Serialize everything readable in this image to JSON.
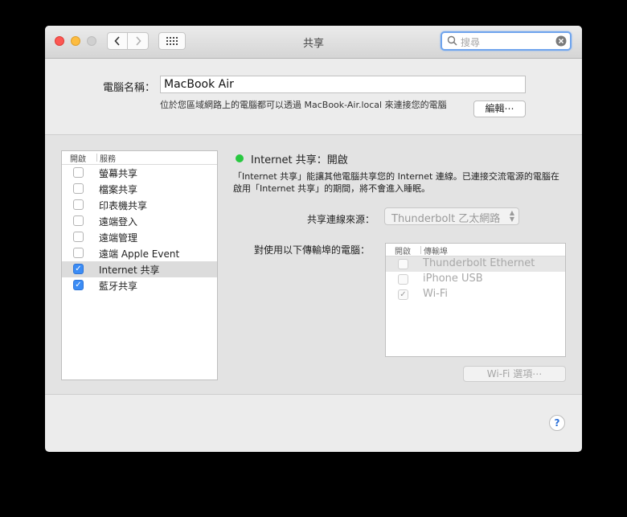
{
  "window": {
    "title": "共享"
  },
  "search": {
    "placeholder": "搜尋"
  },
  "computer_name": {
    "label": "電腦名稱：",
    "value": "MacBook Air",
    "description": "位於您區域網路上的電腦都可以透過 MacBook-Air.local 來連接您的電腦",
    "edit_label": "編輯⋯"
  },
  "services": {
    "col_on": "開啟",
    "col_service": "服務",
    "items": [
      {
        "label": "螢幕共享",
        "checked": false
      },
      {
        "label": "檔案共享",
        "checked": false
      },
      {
        "label": "印表機共享",
        "checked": false
      },
      {
        "label": "遠端登入",
        "checked": false
      },
      {
        "label": "遠端管理",
        "checked": false
      },
      {
        "label": "遠端 Apple Event",
        "checked": false
      },
      {
        "label": "Internet 共享",
        "checked": true,
        "selected": true
      },
      {
        "label": "藍牙共享",
        "checked": true
      }
    ]
  },
  "detail": {
    "status": "Internet 共享：開啟",
    "status_color": "#28c840",
    "description": "「Internet 共享」能讓其他電腦共享您的 Internet 連線。已連接交流電源的電腦在啟用「Internet 共享」的期間，將不會進入睡眠。",
    "share_from_label": "共享連線來源：",
    "share_from_value": "Thunderbolt 乙太網路",
    "to_computers_label": "對使用以下傳輸埠的電腦：",
    "ports": {
      "col_on": "開啟",
      "col_port": "傳輸埠",
      "items": [
        {
          "label": "Thunderbolt Ethernet",
          "checked": false
        },
        {
          "label": "iPhone USB",
          "checked": false
        },
        {
          "label": "Wi-Fi",
          "checked": true
        }
      ]
    },
    "wifi_options_label": "Wi-Fi 選項⋯"
  },
  "help": {
    "label": "?"
  }
}
